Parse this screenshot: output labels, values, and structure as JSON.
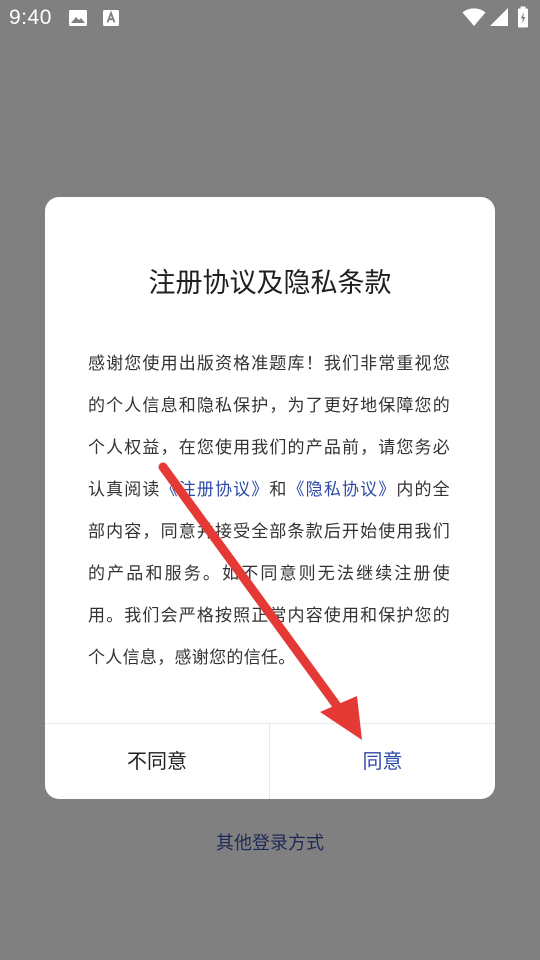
{
  "status_bar": {
    "time": "9:40",
    "icons": [
      "image-icon",
      "font-download-icon",
      "wifi-icon",
      "cellular-signal-icon",
      "battery-icon"
    ]
  },
  "dialog": {
    "title": "注册协议及隐私条款",
    "body": {
      "before_link1": "感谢您使用出版资格准题库！我们非常重视您的个人信息和隐私保护，为了更好地保障您的个人权益，在您使用我们的产品前，请您务必认真阅读",
      "link1": "《注册协议》",
      "between_links": "和",
      "link2": "《隐私协议》",
      "after_link2": "内的全部内容，同意并接受全部条款后开始使用我们的产品和服务。如不同意则无法继续注册使用。我们会严格按照正常内容使用和保护您的个人信息，感谢您的信任。"
    },
    "disagree_label": "不同意",
    "agree_label": "同意"
  },
  "other_login_label": "其他登录方式",
  "colors": {
    "backdrop": "#808080",
    "link": "#2c4aa8",
    "arrow": "#e53935"
  }
}
